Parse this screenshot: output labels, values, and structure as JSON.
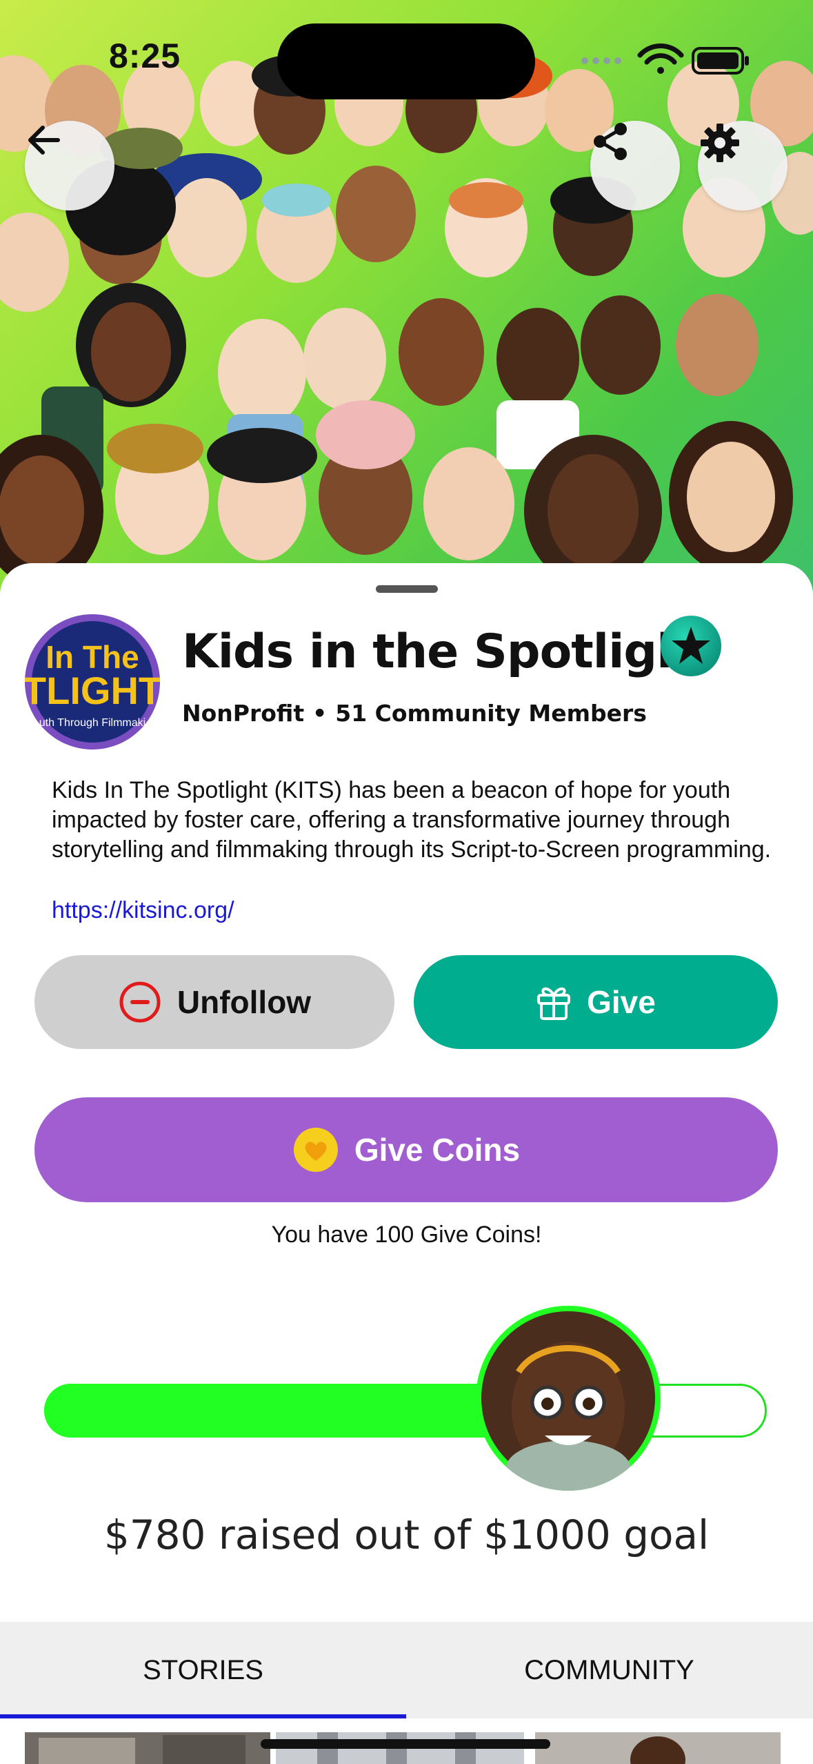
{
  "status_bar": {
    "time": "8:25"
  },
  "nav": {
    "back_icon": "arrow-left-icon",
    "share_icon": "share-icon",
    "settings_icon": "gear-icon"
  },
  "profile": {
    "name": "Kids in the Spotlight",
    "logo_text_line1": "In The",
    "logo_text_line2": "TLIGHT",
    "logo_text_line3": "uth Through Filmmaki",
    "category": "NonProfit",
    "separator": "•",
    "members": "51 Community Members",
    "description": "Kids In The Spotlight (KITS) has been a beacon of hope for youth impacted by foster care, offering a transformative journey through storytelling and filmmaking through its Script-to-Screen programming.",
    "website": "https://kitsinc.org/"
  },
  "actions": {
    "unfollow_label": "Unfollow",
    "give_label": "Give",
    "give_coins_label": "Give Coins",
    "coins_note": "You have 100 Give Coins!"
  },
  "fundraiser": {
    "raised": 780,
    "goal": 1000,
    "progress_fraction": 0.78,
    "summary": "$780 raised out of $1000 goal"
  },
  "tabs": [
    {
      "label": "STORIES",
      "selected": true
    },
    {
      "label": "COMMUNITY",
      "selected": false
    }
  ],
  "colors": {
    "accent_green": "#00ad8e",
    "coins_purple": "#a15ed1",
    "progress_green": "#22ff22",
    "link_blue": "#1a1ad6"
  }
}
